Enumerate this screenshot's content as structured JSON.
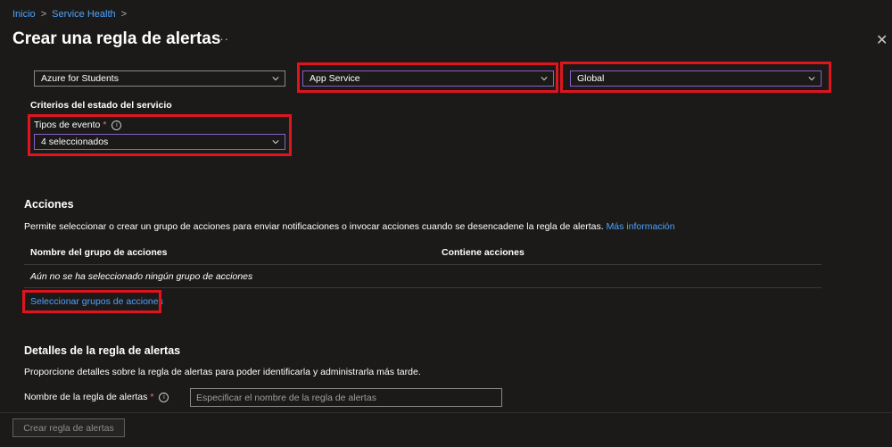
{
  "breadcrumb": {
    "items": [
      "Inicio",
      "Service Health"
    ],
    "separator": ">"
  },
  "page_title": "Crear una regla de alertas",
  "more_label": "···",
  "close_label": "✕",
  "scope": {
    "subscription": "Azure for Students",
    "service": "App Service",
    "region": "Global"
  },
  "criteria": {
    "heading": "Criterios del estado del servicio",
    "event_types_label": "Tipos de evento",
    "required_mark": "*",
    "event_types_value": "4 seleccionados"
  },
  "actions": {
    "title": "Acciones",
    "description": "Permite seleccionar o crear un grupo de acciones para enviar notificaciones o invocar acciones cuando se desencadene la regla de alertas.",
    "more_info": "Más información",
    "columns": [
      "Nombre del grupo de acciones",
      "Contiene acciones"
    ],
    "empty_text": "Aún no se ha seleccionado ningún grupo de acciones",
    "select_link": "Seleccionar grupos de acciones"
  },
  "details": {
    "title": "Detalles de la regla de alertas",
    "description": "Proporcione detalles sobre la regla de alertas para poder identificarla y administrarla más tarde.",
    "rule_name_label": "Nombre de la regla de alertas",
    "required_mark": "*",
    "rule_name_placeholder": "Especificar el nombre de la regla de alertas"
  },
  "footer": {
    "create_button": "Crear regla de alertas"
  },
  "colors": {
    "background": "#1b1a19",
    "link": "#4da3ff",
    "highlight": "#e0141e",
    "focus_border": "#8a60c8"
  }
}
